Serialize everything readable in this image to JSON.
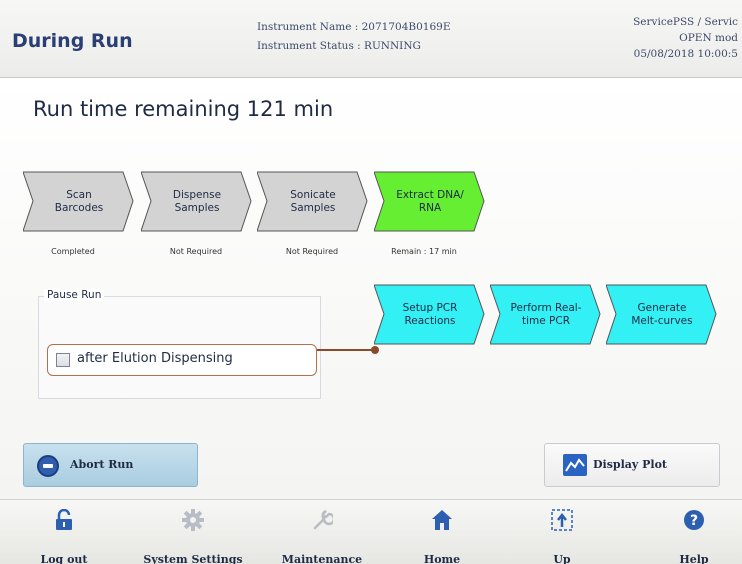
{
  "header": {
    "title": "During Run",
    "instrument_name": "Instrument Name : 2071704B0169E",
    "instrument_status": "Instrument Status : RUNNING",
    "user": "ServicePSS / Servic",
    "mode": "OPEN mod",
    "datetime": "05/08/2018 10:00:5"
  },
  "run": {
    "remaining": "Run time remaining 121 min"
  },
  "steps": [
    {
      "line1": "Scan",
      "line2": "Barcodes",
      "status": "Completed",
      "color": "#d3d3d3"
    },
    {
      "line1": "Dispense",
      "line2": "Samples",
      "status": "Not Required",
      "color": "#d3d3d3"
    },
    {
      "line1": "Sonicate",
      "line2": "Samples",
      "status": "Not Required",
      "color": "#d3d3d3"
    },
    {
      "line1": "Extract DNA/",
      "line2": "RNA",
      "status": "Remain : 17 min",
      "color": "#66ee33"
    },
    {
      "line1": "Setup PCR",
      "line2": "Reactions",
      "status": "",
      "color": "#33f0f5"
    },
    {
      "line1": "Perform Real-",
      "line2": "time PCR",
      "status": "",
      "color": "#33f0f5"
    },
    {
      "line1": "Generate",
      "line2": "Melt-curves",
      "status": "",
      "color": "#33f0f5"
    }
  ],
  "pause": {
    "legend": "Pause Run",
    "option_label": "after Elution Dispensing",
    "checked": false
  },
  "buttons": {
    "abort": "Abort Run",
    "plot": "Display Plot"
  },
  "footer": [
    {
      "label": "Log out",
      "icon": "lock-icon"
    },
    {
      "label": "System Settings",
      "icon": "gear-icon"
    },
    {
      "label": "Maintenance",
      "icon": "wrench-icon"
    },
    {
      "label": "Home",
      "icon": "home-icon"
    },
    {
      "label": "Up",
      "icon": "up-icon"
    },
    {
      "label": "Help",
      "icon": "help-icon"
    }
  ]
}
